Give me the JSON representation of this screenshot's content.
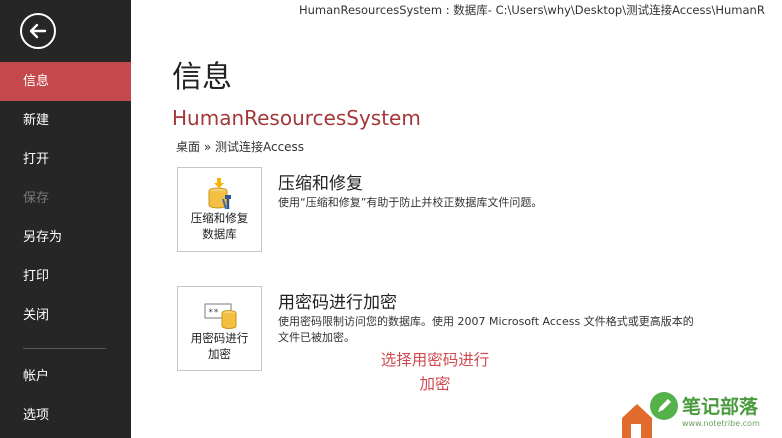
{
  "window": {
    "title": "HumanResourcesSystem : 数据库- C:\\Users\\why\\Desktop\\测试连接Access\\HumanR"
  },
  "sidebar": {
    "back_icon": "back-arrow-icon",
    "items": [
      {
        "label": "信息",
        "state": "active"
      },
      {
        "label": "新建",
        "state": "normal"
      },
      {
        "label": "打开",
        "state": "normal"
      },
      {
        "label": "保存",
        "state": "disabled"
      },
      {
        "label": "另存为",
        "state": "normal"
      },
      {
        "label": "打印",
        "state": "normal"
      },
      {
        "label": "关闭",
        "state": "normal"
      },
      {
        "label": "帐户",
        "state": "normal"
      },
      {
        "label": "选项",
        "state": "normal"
      }
    ]
  },
  "main": {
    "title": "信息",
    "db_name": "HumanResourcesSystem",
    "breadcrumb": "桌面 » 测试连接Access",
    "sections": [
      {
        "tile_label_line1": "压缩和修复",
        "tile_label_line2": "数据库",
        "heading": "压缩和修复",
        "description_line1": "使用“压缩和修复”有助于防止并校正数据库文件问题。",
        "description_line2": "",
        "icon": "database-repair-icon"
      },
      {
        "tile_label_line1": "用密码进行",
        "tile_label_line2": "加密",
        "heading": "用密码进行加密",
        "description_line1": "使用密码限制访问您的数据库。使用 2007 Microsoft Access 文件格式或更高版本的",
        "description_line2": "文件已被加密。",
        "icon": "database-lock-icon"
      }
    ],
    "annotation_line1": "选择用密码进行",
    "annotation_line2": "加密"
  },
  "watermark": {
    "text": "笔记部落",
    "sub": "www.notetribe.com"
  },
  "colors": {
    "sidebar_bg": "#262626",
    "active_item": "#c4494c",
    "db_name": "#a4373a",
    "annotation": "#d04a50"
  }
}
